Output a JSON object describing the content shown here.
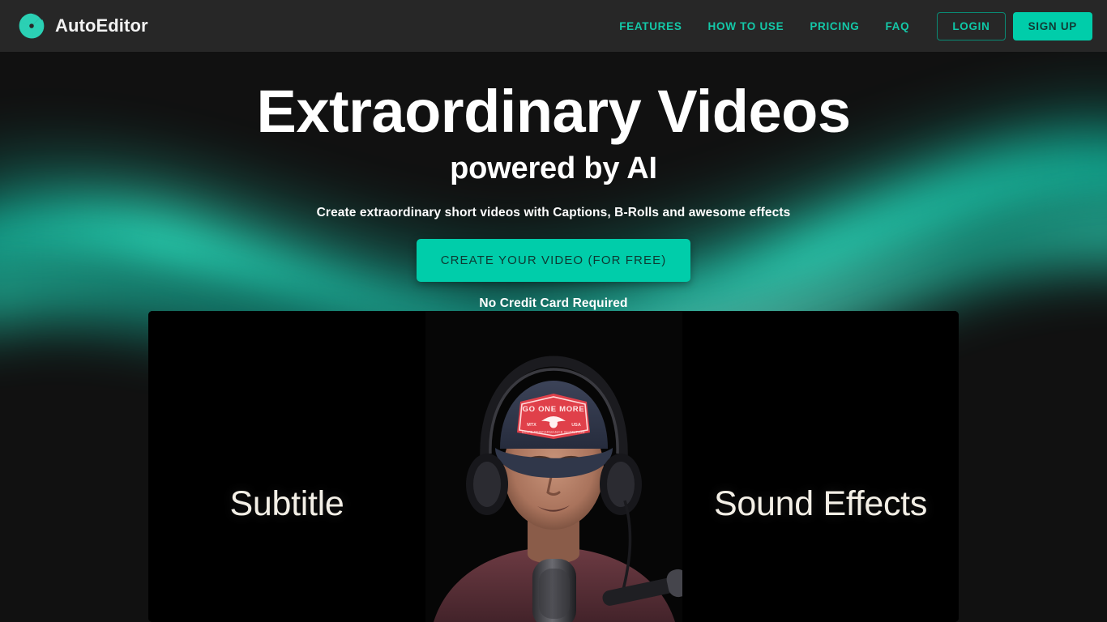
{
  "brand": {
    "name": "AutoEditor",
    "logo_icon": "aperture-icon",
    "accent_color": "#00cdaa"
  },
  "header": {
    "background_color": "#272727",
    "nav_items": [
      {
        "label": "FEATURES"
      },
      {
        "label": "HOW TO USE"
      },
      {
        "label": "PRICING"
      },
      {
        "label": "FAQ"
      }
    ],
    "login_label": "LOGIN",
    "signup_label": "SIGN UP"
  },
  "hero": {
    "background_color": "#111111",
    "headline": "Extraordinary Videos",
    "subhead": "powered by AI",
    "tagline": "Create extraordinary short videos with Captions, B-Rolls and awesome effects",
    "cta_label": "CREATE YOUR VIDEO (FOR FREE)",
    "no_card_text": "No Credit Card Required"
  },
  "showcase": {
    "left_overlay": "Subtitle",
    "right_overlay": "Sound Effects",
    "video": {
      "description": "man-with-headphones-speaking-into-microphone",
      "cap_patch_line1": "GO ONE MORE",
      "cap_patch_line2": "MTX",
      "cap_patch_line3": "USA",
      "cap_patch_line4": "ELITE PERFORMANCE NUTRITION"
    }
  }
}
